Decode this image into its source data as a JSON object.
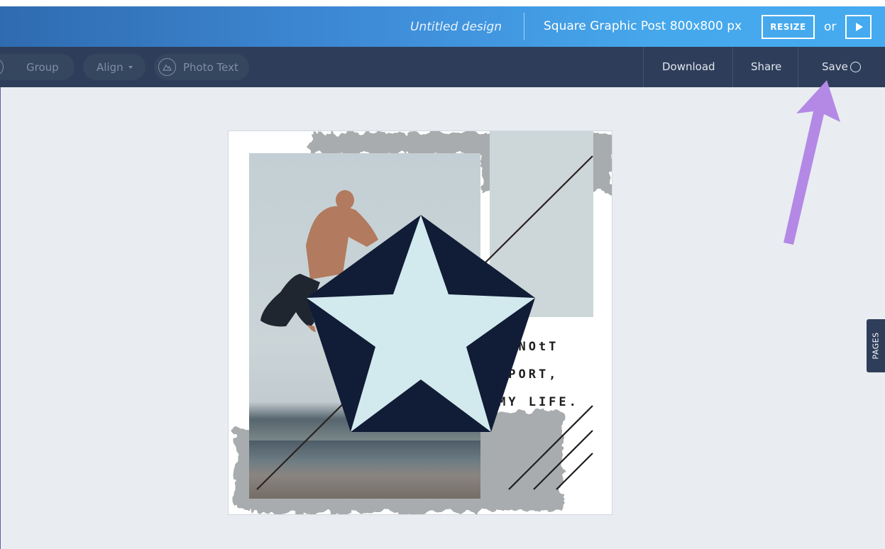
{
  "header": {
    "title": "Untitled design",
    "format": "Square Graphic Post 800x800 px",
    "resize_label": "RESIZE",
    "or_label": "or",
    "play_icon": "play-icon"
  },
  "toolbar": {
    "group_label": "Group",
    "align_label": "Align",
    "photo_text_label": "Photo Text",
    "download_label": "Download",
    "share_label": "Share",
    "save_label": "Save"
  },
  "design": {
    "poem_lines": [
      "S NOtT",
      "SPORT,",
      "MY LIFE."
    ],
    "star_fill": "#d2eaee",
    "pentagon_fill": "#111c36"
  },
  "pages_tab": {
    "label": "PAGES"
  },
  "colors": {
    "topbar_start": "#2f6bb0",
    "topbar_end": "#45aaef",
    "toolbar_bg": "#2e3e5a",
    "canvas_bg": "#e9edf1",
    "annotation_arrow": "#b489e6"
  }
}
